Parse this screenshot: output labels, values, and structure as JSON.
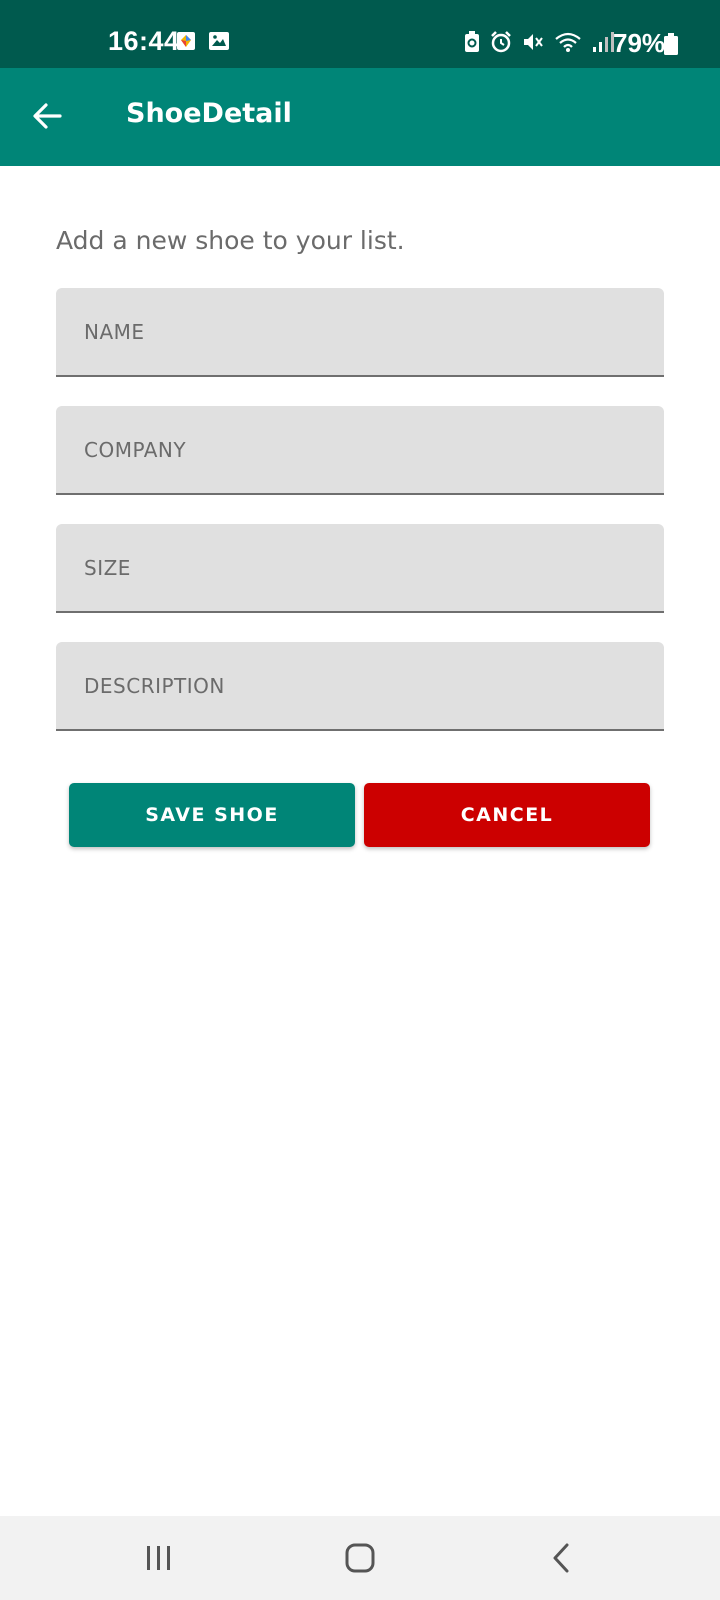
{
  "status_bar": {
    "time": "16:44",
    "battery_percent": "79%",
    "icons": [
      "gallery-app-icon",
      "image-icon",
      "battery-saver-icon",
      "alarm-icon",
      "mute-icon",
      "wifi-icon",
      "signal-icon",
      "battery-icon"
    ]
  },
  "app_bar": {
    "title": "ShoeDetail",
    "back_icon": "arrow-left-icon",
    "color": "#008577"
  },
  "form": {
    "subtitle": "Add a new shoe to your list.",
    "fields": [
      {
        "placeholder": "NAME",
        "value": ""
      },
      {
        "placeholder": "COMPANY",
        "value": ""
      },
      {
        "placeholder": "SIZE",
        "value": ""
      },
      {
        "placeholder": "DESCRIPTION",
        "value": ""
      }
    ]
  },
  "buttons": {
    "save_label": "SAVE SHOE",
    "save_color": "#008577",
    "cancel_label": "CANCEL",
    "cancel_color": "#cc0000"
  },
  "nav_bar": {
    "icons": [
      "recents-icon",
      "home-icon",
      "back-icon"
    ]
  }
}
